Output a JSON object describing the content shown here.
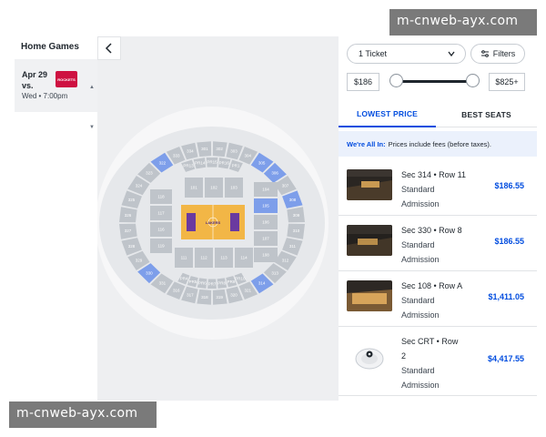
{
  "watermark": "m-cnweb-ayx.com",
  "left": {
    "title": "Home Games",
    "event": {
      "date": "Apr 29",
      "vs": "vs.",
      "time": "Wed • 7:00pm",
      "opponent_logo_text": "ROCKETS"
    }
  },
  "map": {
    "sections_top": [
      "333",
      "334",
      "301",
      "302",
      "303",
      "304"
    ],
    "sections_upper_left": [
      "331",
      "330",
      "329",
      "328",
      "327",
      "326",
      "325",
      "324",
      "323",
      "322"
    ],
    "sections_upper_right": [
      "305",
      "306",
      "307",
      "308",
      "309",
      "310",
      "311",
      "312",
      "313",
      "314"
    ],
    "sections_bottom": [
      "321",
      "320",
      "319",
      "318",
      "317",
      "316"
    ],
    "premier_top": [
      "PR13",
      "PR14",
      "PR15",
      "PR16",
      "PR1"
    ],
    "premier_bottom": [
      "PR10",
      "PR9",
      "PR8",
      "PR7",
      "PR6",
      "PR5",
      "PR4"
    ],
    "lower_top": [
      "101",
      "102",
      "103"
    ],
    "lower_bottom": [
      "111",
      "112",
      "113",
      "114"
    ],
    "lower_left": [
      "118",
      "117",
      "116",
      "119"
    ],
    "lower_right": [
      "104",
      "105",
      "106",
      "107",
      "108"
    ],
    "court_label": "LAKERS",
    "highlighted": [
      "306",
      "305",
      "330",
      "322",
      "308",
      "105",
      "314"
    ]
  },
  "right": {
    "ticket_select": "1 Ticket",
    "filters_label": "Filters",
    "price_min": "$186",
    "price_max": "$825+",
    "slider": {
      "min_fraction": 0.0,
      "max_fraction": 1.0
    },
    "tabs": [
      "LOWEST PRICE",
      "BEST SEATS"
    ],
    "fees_banner": {
      "bold": "We're All In:",
      "text": "Prices include fees (before taxes)."
    },
    "listings": [
      {
        "section": "Sec 314 • Row 11",
        "type1": "Standard",
        "type2": "Admission",
        "price": "$186.55"
      },
      {
        "section": "Sec 330 • Row 8",
        "type1": "Standard",
        "type2": "Admission",
        "price": "$186.55"
      },
      {
        "section": "Sec 108 • Row A",
        "type1": "Standard",
        "type2": "Admission",
        "price": "$1,411.05"
      },
      {
        "section": "Sec CRT • Row",
        "section2": "2",
        "type1": "Standard",
        "type2": "Admission",
        "price": "$4,417.55"
      }
    ]
  },
  "colors": {
    "accent": "#024ddf",
    "highlight_section": "#7d9eea",
    "section": "#bfc4ca",
    "court": "#f2b646",
    "logo": "#ce1141"
  }
}
